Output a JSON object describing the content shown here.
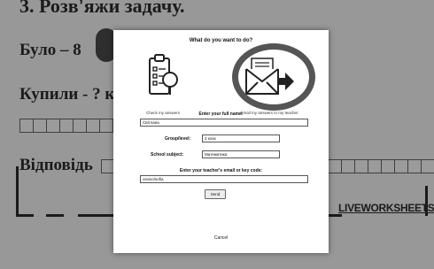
{
  "worksheet": {
    "heading": "3. Розв'яжи задачу.",
    "line1": "Було – 8",
    "line2": "Купили - ? к",
    "line3": "Відповідь",
    "brand": "LIVEWORKSHEETS"
  },
  "dialog": {
    "title": "What do you want to do?",
    "option_check_label": "Check my answers",
    "option_email_label": "Email my answers to my teacher",
    "name_label": "Enter your full name:",
    "name_value": "Світлана",
    "group_label": "Group/level:",
    "group_value": "3 клас",
    "subject_label": "School subject:",
    "subject_value": "Математика",
    "teacher_label": "Enter your teacher's email or key code:",
    "teacher_value": "osvivo/sofia",
    "send_label": "Send",
    "cancel_label": "Cancel"
  },
  "colors": {
    "highlight_ring": "#555555",
    "dialog_bg": "#ffffff",
    "overlay": "#282828"
  },
  "icons": {
    "check": "clipboard-check-icon",
    "email": "envelope-send-icon"
  }
}
